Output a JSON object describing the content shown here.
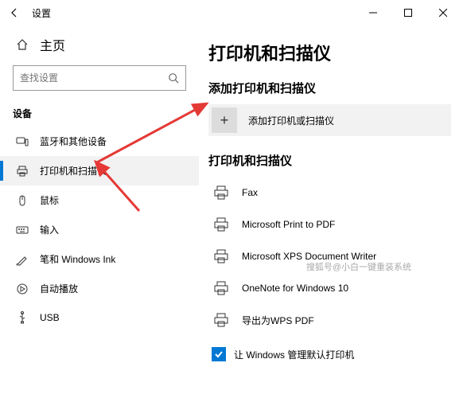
{
  "titlebar": {
    "title": "设置"
  },
  "sidebar": {
    "home": "主页",
    "search_placeholder": "查找设置",
    "section": "设备",
    "items": [
      {
        "label": "蓝牙和其他设备"
      },
      {
        "label": "打印机和扫描仪"
      },
      {
        "label": "鼠标"
      },
      {
        "label": "输入"
      },
      {
        "label": "笔和 Windows Ink"
      },
      {
        "label": "自动播放"
      },
      {
        "label": "USB"
      }
    ]
  },
  "main": {
    "title": "打印机和扫描仪",
    "add_section": "添加打印机和扫描仪",
    "add_button": "添加打印机或扫描仪",
    "list_section": "打印机和扫描仪",
    "printers": [
      {
        "label": "Fax"
      },
      {
        "label": "Microsoft Print to PDF"
      },
      {
        "label": "Microsoft XPS Document Writer"
      },
      {
        "label": "OneNote for Windows 10"
      },
      {
        "label": "导出为WPS PDF"
      }
    ],
    "checkbox_label": "让 Windows 管理默认打印机"
  },
  "watermark": "搜狐号@小白一键重装系统"
}
